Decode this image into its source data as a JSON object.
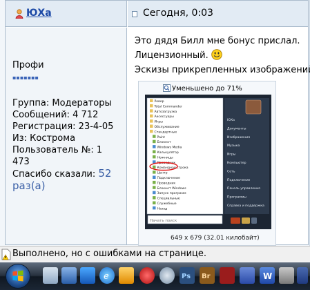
{
  "post": {
    "username": "ЮХа",
    "date": "Сегодня, 0:03",
    "message_line1": "Это дядя Билл мне бонус прислал.",
    "message_line2": "Лицензионный.",
    "message_line3": "Эскизы прикрепленных изображений"
  },
  "profile": {
    "rank": "Профи",
    "rank_dots": "▪▪▪▪▪▪▪",
    "group": "Группа: Модераторы",
    "posts": "Сообщений: 4 712",
    "registered": "Регистрация: 23-4-05",
    "from": "Из: Кострома",
    "user_number_label": "Пользователь №: 1",
    "user_number_cont": "473",
    "thanks_label": "Спасибо сказали: ",
    "thanks_count": "52",
    "thanks_suffix": "раз(а)"
  },
  "attachment": {
    "caption": "Уменьшено до 71%",
    "dimensions": "649 x 679 (32.01 килобайт)",
    "start_menu_items": [
      "Ровер",
      "Total Commander",
      "Автозагрузка",
      "Аксессуары",
      "Игры",
      "Обслуживание",
      "Стандартные",
      "Paint",
      "Блокнот",
      "Windows Media",
      "Калькулятор",
      "Ножницы",
      "Проводник",
      "Командная строка",
      "Центр",
      "Подключение",
      "Проводник",
      "Блокнот Windows",
      "Запуск программ",
      "Специальные",
      "Служебные",
      "Назад"
    ],
    "search_placeholder": "Начать поиск",
    "right_menu_items": [
      "ЮХа",
      "Документы",
      "Изображения",
      "Музыка",
      "Игры",
      "Компьютер",
      "Сеть",
      "Подключение",
      "Панель управления",
      "Программы",
      "Справка и поддержка"
    ]
  },
  "statusbar": {
    "text": "Выполнено, но с ошибками на странице."
  },
  "taskbar": {
    "apps": [
      "start-orb",
      "explorer",
      "desktop",
      "internet-explorer",
      "media-player",
      "opera",
      "skype",
      "photoshop",
      "bridge",
      "flash",
      "word",
      "acrobat",
      "more"
    ]
  }
}
